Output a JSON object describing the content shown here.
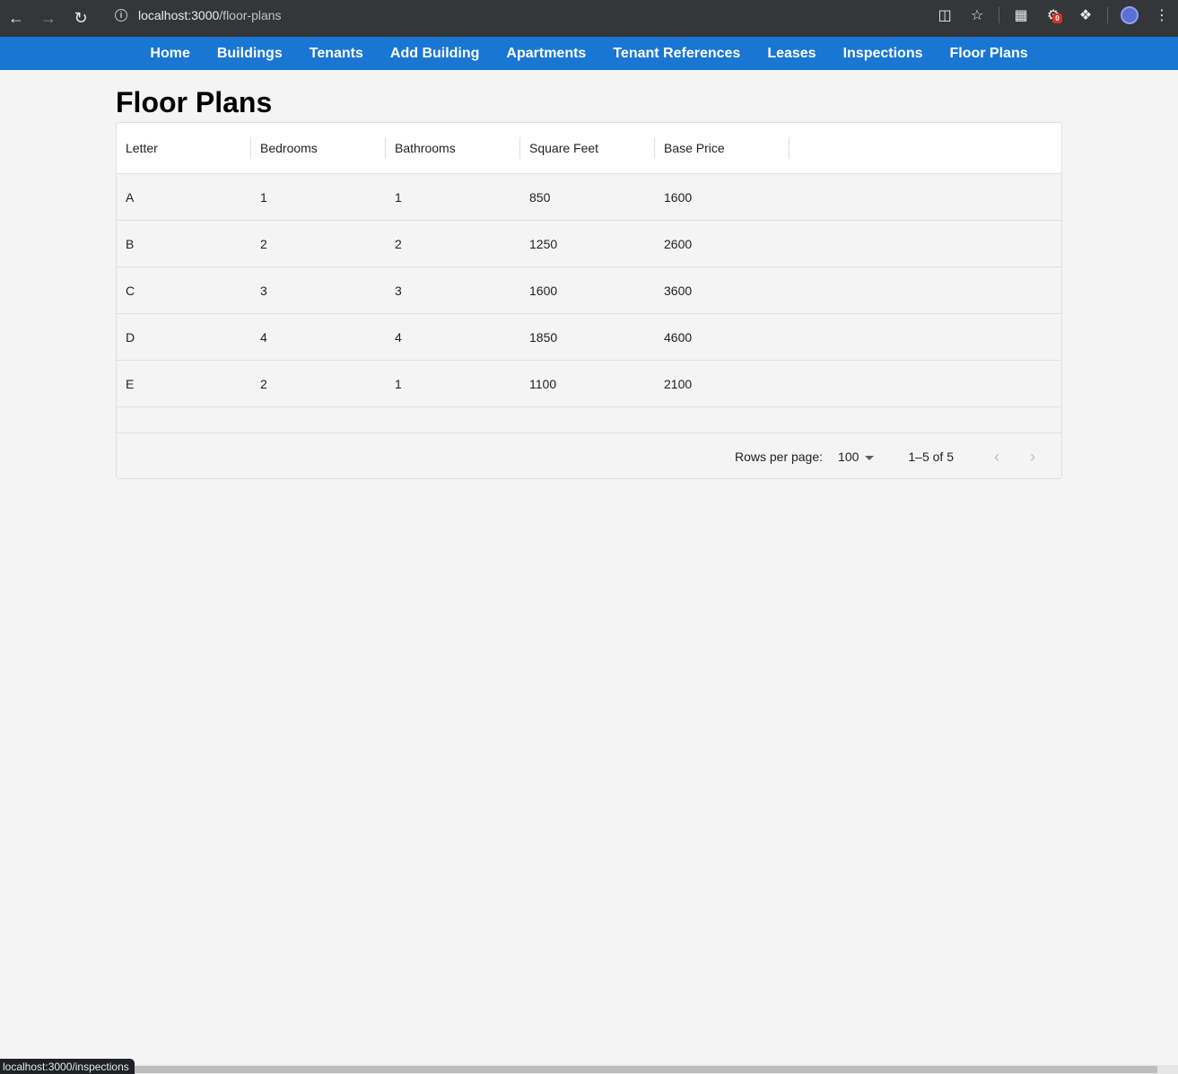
{
  "browser": {
    "url_host": "localhost:3000",
    "url_path": "/floor-plans",
    "status_url": "localhost:3000/inspections",
    "extension_badge": "0"
  },
  "nav": {
    "items": [
      "Home",
      "Buildings",
      "Tenants",
      "Add Building",
      "Apartments",
      "Tenant References",
      "Leases",
      "Inspections",
      "Floor Plans"
    ]
  },
  "page": {
    "title": "Floor Plans"
  },
  "table": {
    "columns": [
      "Letter",
      "Bedrooms",
      "Bathrooms",
      "Square Feet",
      "Base Price"
    ],
    "rows": [
      [
        "A",
        "1",
        "1",
        "850",
        "1600"
      ],
      [
        "B",
        "2",
        "2",
        "1250",
        "2600"
      ],
      [
        "C",
        "3",
        "3",
        "1600",
        "3600"
      ],
      [
        "D",
        "4",
        "4",
        "1850",
        "4600"
      ],
      [
        "E",
        "2",
        "1",
        "1100",
        "2100"
      ]
    ]
  },
  "pagination": {
    "rows_per_page_label": "Rows per page:",
    "rows_per_page_value": "100",
    "range_label": "1–5 of 5"
  }
}
